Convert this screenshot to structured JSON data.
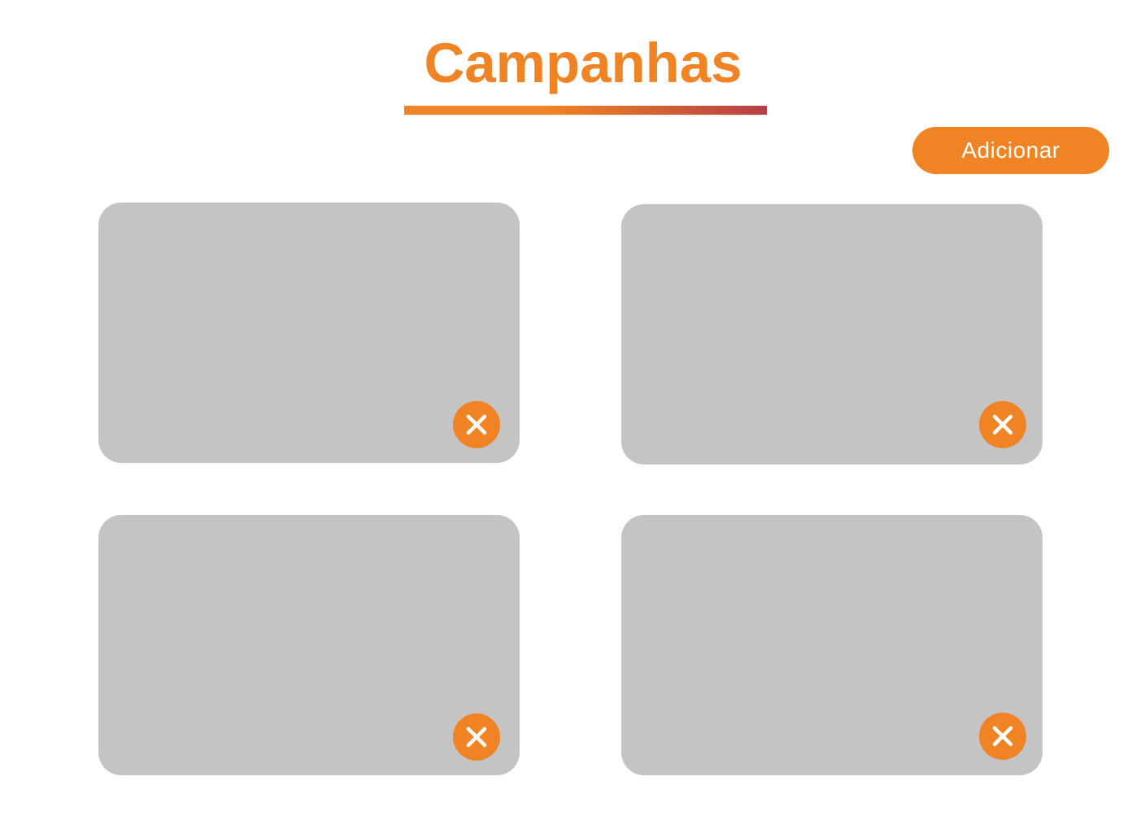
{
  "page": {
    "title": "Campanhas"
  },
  "toolbar": {
    "add_label": "Adicionar"
  },
  "campaigns": [
    {
      "remove_icon": "close-icon"
    },
    {
      "remove_icon": "close-icon"
    },
    {
      "remove_icon": "close-icon"
    },
    {
      "remove_icon": "close-icon"
    }
  ],
  "colors": {
    "accent": "#F08323",
    "accent_dark": "#B83E45",
    "card_background": "#C4C4C4",
    "background": "#FFFFFF",
    "icon_foreground": "#FFFFFF"
  }
}
